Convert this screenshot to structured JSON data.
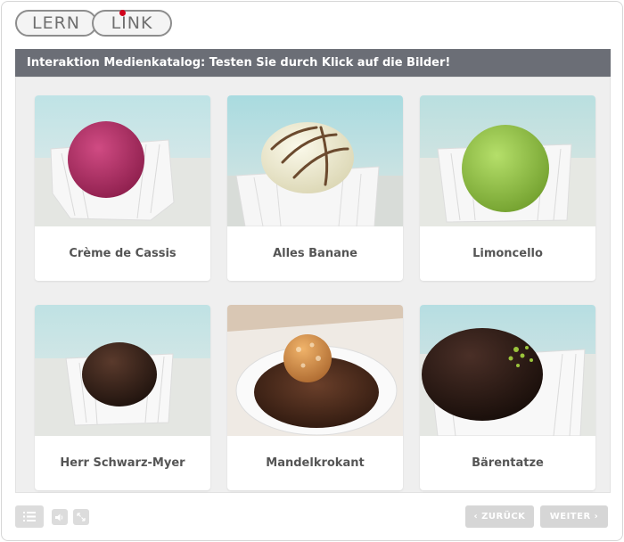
{
  "logo": {
    "left": "LERN",
    "right": "LINK"
  },
  "title": "Interaktion Medienkatalog: Testen Sie durch Klick auf die Bilder!",
  "cards": [
    {
      "label": "Crème de Cassis",
      "image": "pink-praline-photo"
    },
    {
      "label": "Alles Banane",
      "image": "white-chocolate-praline-photo"
    },
    {
      "label": "Limoncello",
      "image": "green-sugar-praline-photo"
    },
    {
      "label": "Herr Schwarz-Myer",
      "image": "dark-chocolate-praline-photo"
    },
    {
      "label": "Mandelkrokant",
      "image": "almond-brittle-praline-photo"
    },
    {
      "label": "Bärentatze",
      "image": "dark-praline-pistachio-photo"
    }
  ],
  "footer": {
    "menu_icon": "list-icon",
    "sound_icon": "speaker-icon",
    "fullscreen_icon": "expand-icon",
    "back_label": "ZURÜCK",
    "next_label": "WEITER"
  },
  "colors": {
    "title_bar": "#6b6e76",
    "content_bg": "#efefef",
    "button_bg": "#d6d6d6",
    "logo_dot": "#d0021b"
  }
}
